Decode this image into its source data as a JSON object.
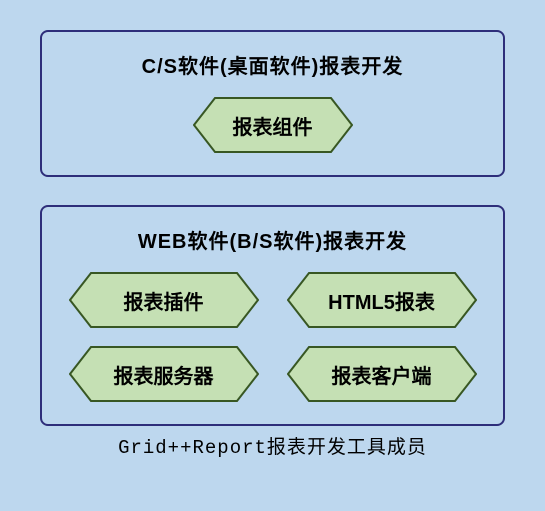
{
  "sections": {
    "cs": {
      "title": "C/S软件(桌面软件)报表开发",
      "items": [
        "报表组件"
      ]
    },
    "web": {
      "title": "WEB软件(B/S软件)报表开发",
      "row1": [
        "报表插件",
        "HTML5报表"
      ],
      "row2": [
        "报表服务器",
        "报表客户端"
      ]
    }
  },
  "caption": "Grid++Report报表开发工具成员",
  "colors": {
    "hex_fill": "#c5e0b4",
    "hex_stroke": "#385723",
    "panel_stroke": "#2e2e7a",
    "bg": "#bdd7ee"
  }
}
